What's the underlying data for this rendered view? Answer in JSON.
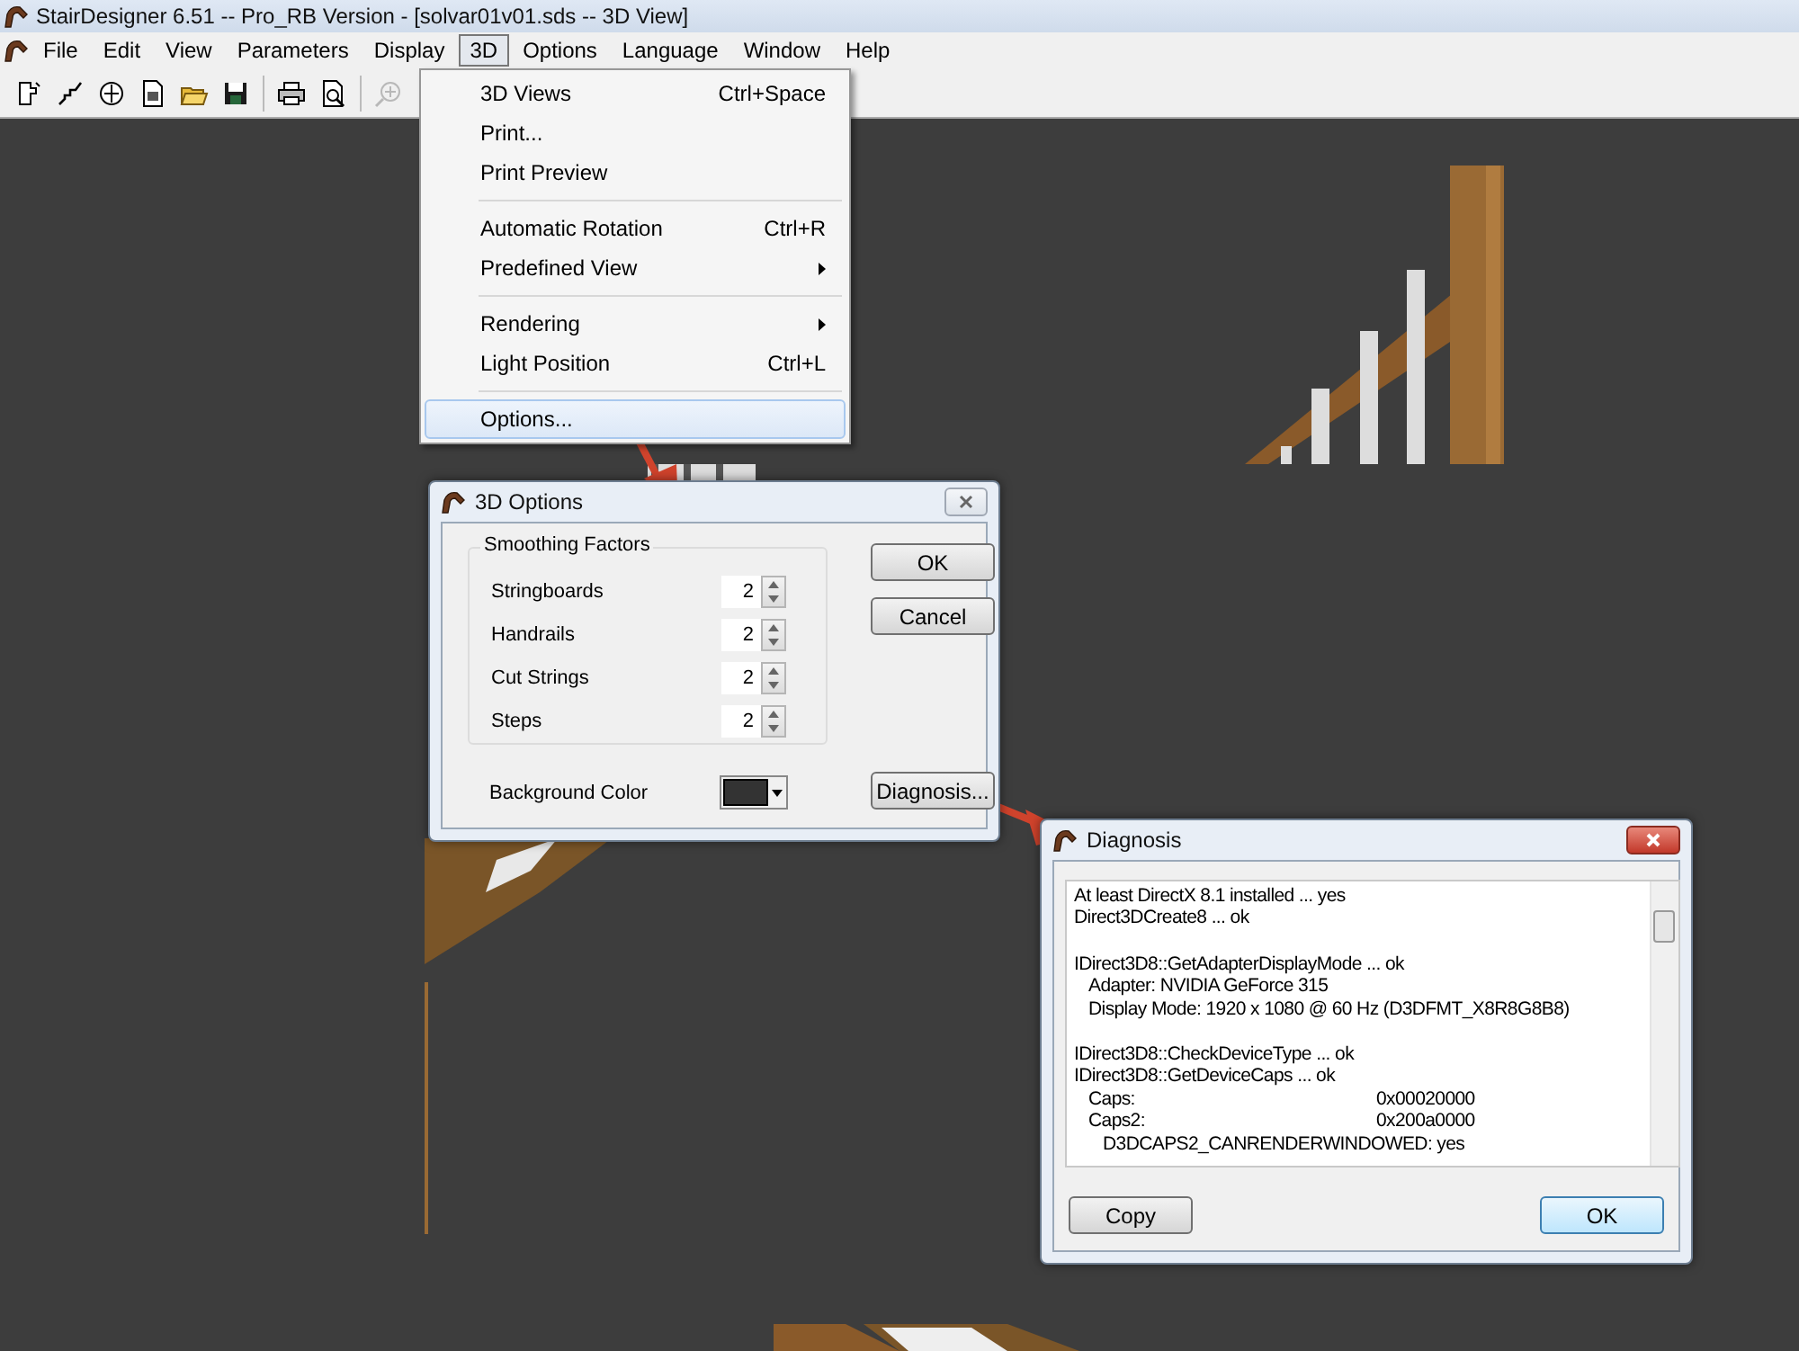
{
  "window": {
    "title": "StairDesigner 6.51 -- Pro_RB Version - [solvar01v01.sds -- 3D View]"
  },
  "menubar": [
    {
      "label": "File",
      "selected": false
    },
    {
      "label": "Edit",
      "selected": false
    },
    {
      "label": "View",
      "selected": false
    },
    {
      "label": "Parameters",
      "selected": false
    },
    {
      "label": "Display",
      "selected": false
    },
    {
      "label": "3D",
      "selected": true
    },
    {
      "label": "Options",
      "selected": false
    },
    {
      "label": "Language",
      "selected": false
    },
    {
      "label": "Window",
      "selected": false
    },
    {
      "label": "Help",
      "selected": false
    }
  ],
  "menu": [
    {
      "kind": "item",
      "label": "3D Views",
      "shortcut": "Ctrl+Space",
      "submenu": false,
      "selected": false
    },
    {
      "kind": "item",
      "label": "Print...",
      "submenu": false,
      "selected": false
    },
    {
      "kind": "item",
      "label": "Print Preview",
      "submenu": false,
      "selected": false
    },
    {
      "kind": "separator"
    },
    {
      "kind": "item",
      "label": "Automatic Rotation",
      "shortcut": "Ctrl+R",
      "submenu": false,
      "selected": false
    },
    {
      "kind": "item",
      "label": "Predefined View",
      "submenu": true,
      "selected": false
    },
    {
      "kind": "separator"
    },
    {
      "kind": "item",
      "label": "Rendering",
      "submenu": true,
      "selected": false
    },
    {
      "kind": "item",
      "label": "Light Position",
      "shortcut": "Ctrl+L",
      "submenu": false,
      "selected": false
    },
    {
      "kind": "separator"
    },
    {
      "kind": "item",
      "label": "Options...",
      "submenu": false,
      "selected": true
    }
  ],
  "options_dialog": {
    "title": "3D Options",
    "group": "Smoothing Factors",
    "factors": [
      {
        "label": "Stringboards",
        "value": "2"
      },
      {
        "label": "Handrails",
        "value": "2"
      },
      {
        "label": "Cut Strings",
        "value": "2"
      },
      {
        "label": "Steps",
        "value": "2"
      }
    ],
    "background": {
      "label": "Background Color",
      "color": "#333333"
    },
    "buttons": [
      "OK",
      "Cancel"
    ],
    "diagnosis_button": "Diagnosis..."
  },
  "diagnosis_dialog": {
    "title": "Diagnosis",
    "paragraphs": [
      [
        {
          "text": "At least DirectX 8.1 installed ... yes"
        },
        {
          "text": "Direct3DCreate8 ... ok"
        }
      ],
      [
        {
          "text": "IDirect3D8::GetAdapterDisplayMode ... ok",
          "children": [
            {
              "text": "Adapter: NVIDIA GeForce 315"
            },
            {
              "text": "Display Mode: 1920 x 1080 @ 60 Hz (D3DFMT_X8R8G8B8)"
            }
          ]
        }
      ],
      [
        {
          "text": "IDirect3D8::CheckDeviceType ... ok"
        },
        {
          "text": "IDirect3D8::GetDeviceCaps ... ok",
          "children": [
            {
              "text": "Caps:",
              "value": "0x00020000"
            },
            {
              "text": "Caps2:",
              "value": "0x200a0000",
              "children": [
                {
                  "text": "D3DCAPS2_CANRENDERWINDOWED: yes"
                }
              ]
            }
          ]
        }
      ]
    ],
    "buttons": [
      {
        "label": "Copy",
        "default": false
      },
      {
        "label": "OK",
        "default": true
      }
    ]
  }
}
